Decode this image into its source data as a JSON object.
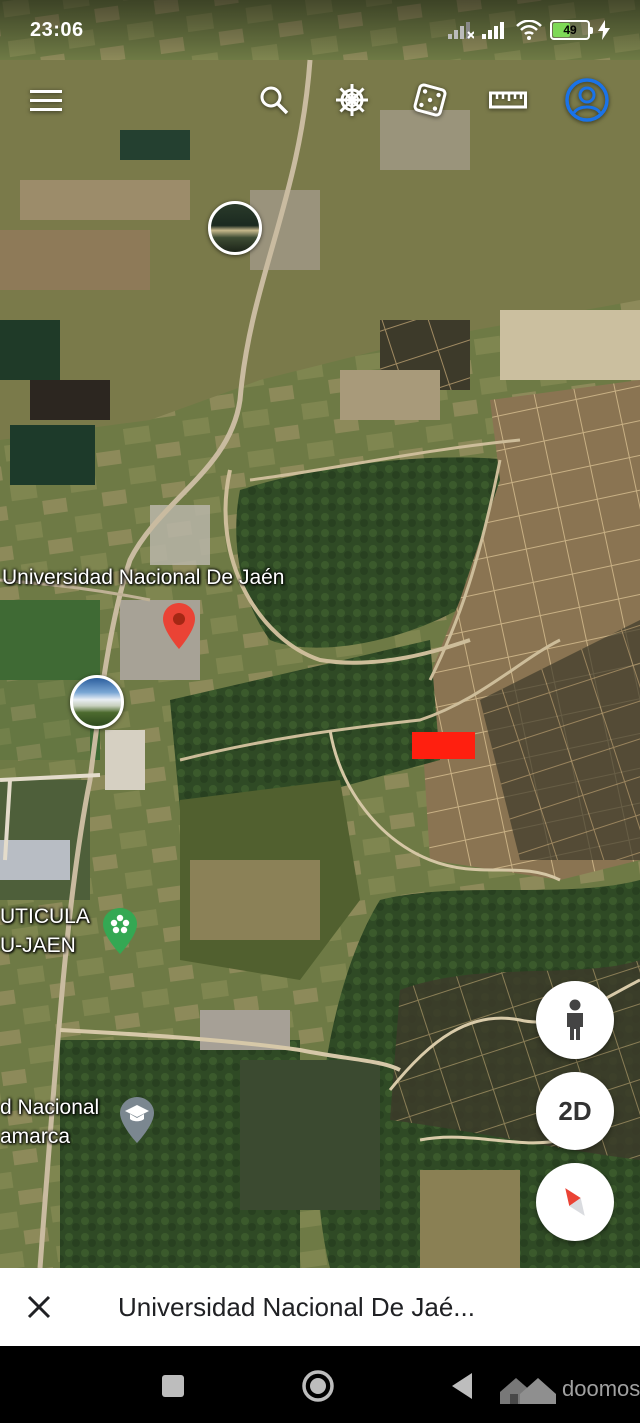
{
  "status_bar": {
    "time": "23:06",
    "battery_level": "49",
    "battery_fraction": 0.49,
    "icons": [
      "no-signal-icon",
      "signal-bars-icon",
      "wifi-icon",
      "battery-icon",
      "charging-bolt-icon"
    ]
  },
  "toolbar": {
    "icons": [
      "menu-icon",
      "search-icon",
      "voyager-helm-icon",
      "feeling-lucky-dice-icon",
      "measure-ruler-icon",
      "account-avatar-icon"
    ],
    "accent_color": "#1a73e8"
  },
  "map": {
    "labels": {
      "university_unj": "Universidad Nacional De Jaén",
      "poi_partial_1": "UTICULA",
      "poi_partial_2": "U-JAEN",
      "university_partial_1": "d Nacional",
      "university_partial_2": "amarca"
    },
    "pins": [
      "photo-pin-north",
      "photo-pin-west",
      "red-location-pin",
      "green-flower-poi-icon",
      "graduation-cap-poi-icon"
    ],
    "highlight_color": "#ff1f0f"
  },
  "controls": {
    "street_view_icon": "pegman-icon",
    "view_mode_label": "2D",
    "compass_icon": "compass-icon"
  },
  "bottom_sheet": {
    "title": "Universidad Nacional De Jaé..."
  },
  "nav_bar": {
    "icons": [
      "recents-square-icon",
      "home-circle-icon",
      "back-triangle-icon"
    ],
    "watermark": "doomos"
  }
}
